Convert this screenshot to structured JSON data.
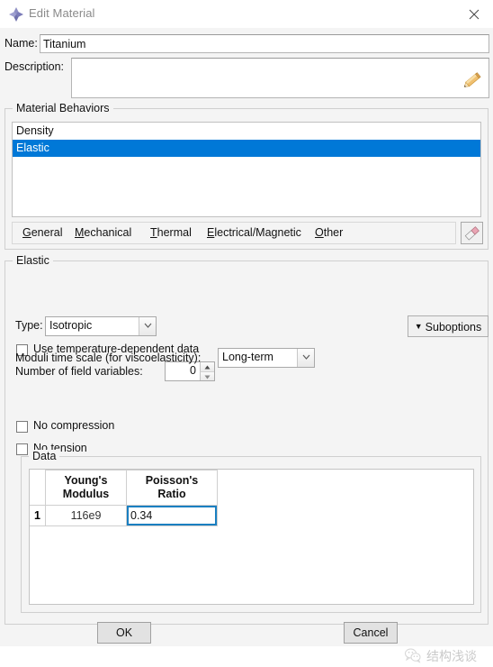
{
  "window": {
    "title": "Edit Material",
    "icon": "abaqus-diamond-icon",
    "close_label": "✕"
  },
  "fields": {
    "name_label": "Name:",
    "name_value": "Titanium",
    "name_placeholder": "",
    "description_label": "Description:",
    "description_value": "",
    "description_placeholder": "",
    "edit_pencil_icon": "pencil-icon"
  },
  "behaviors": {
    "group_title": "Material Behaviors",
    "items": [
      {
        "label": "Density",
        "selected": false
      },
      {
        "label": "Elastic",
        "selected": true
      }
    ],
    "menu": [
      {
        "label": "General",
        "mnemonic": "G"
      },
      {
        "label": "Mechanical",
        "mnemonic": "M"
      },
      {
        "label": "Thermal",
        "mnemonic": "T"
      },
      {
        "label": "Electrical/Magnetic",
        "mnemonic": "E"
      },
      {
        "label": "Other",
        "mnemonic": "O"
      }
    ],
    "eraser_icon": "eraser-icon"
  },
  "elastic": {
    "group_title": "Elastic",
    "type_label": "Type:",
    "type_value": "Isotropic",
    "suboptions_label": "Suboptions",
    "temp_dependent_label": "Use temperature-dependent data",
    "temp_dependent_checked": false,
    "field_vars_label": "Number of field variables:",
    "field_vars_value": "0",
    "moduli_label": "Moduli time scale (for viscoelasticity):",
    "moduli_value": "Long-term",
    "no_compression_label": "No compression",
    "no_compression_checked": false,
    "no_tension_label": "No tension",
    "no_tension_checked": false
  },
  "data_table": {
    "group_title": "Data",
    "columns": [
      "Young's\nModulus",
      "Poisson's\nRatio"
    ],
    "columns_line1": [
      "Young's",
      "Poisson's"
    ],
    "columns_line2": [
      "Modulus",
      "Ratio"
    ],
    "rows": [
      {
        "num": "1",
        "youngs_modulus": "116e9",
        "poissons_ratio": "0.34"
      }
    ],
    "active_cell": "poissons_ratio"
  },
  "footer": {
    "ok_label": "OK",
    "cancel_label": "Cancel"
  },
  "watermark": {
    "text": "结构浅谈",
    "icon": "wechat-icon"
  },
  "colors": {
    "selection_blue": "#0078d7",
    "active_cell_border": "#1a7fc1",
    "dialog_bg": "#f4f4f4",
    "title_text": "#8a8a8a"
  }
}
